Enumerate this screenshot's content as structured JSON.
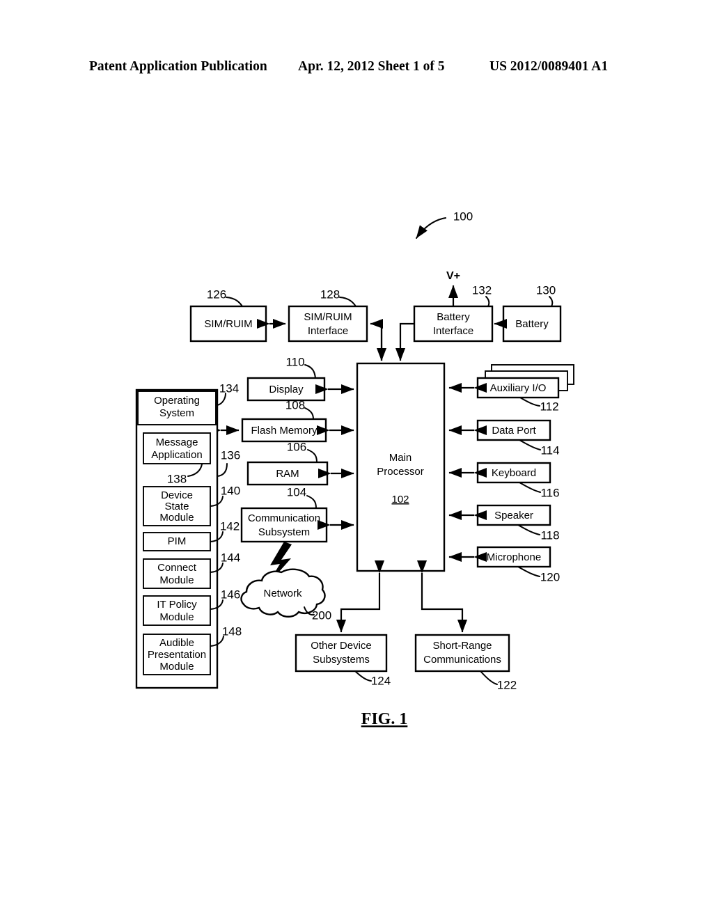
{
  "header": {
    "title": "Patent Application Publication",
    "date": "Apr. 12, 2012",
    "sheet": "Sheet 1 of 5",
    "publication_number": "US 2012/0089401 A1",
    "date_sheet": "Apr. 12, 2012  Sheet 1 of 5"
  },
  "figure": {
    "label": "FIG. 1",
    "overall_ref": "100",
    "power_label": "V+"
  },
  "boxes": {
    "sim_ruim": {
      "label": "SIM/RUIM",
      "ref": "126"
    },
    "sim_ruim_interface": {
      "label_line1": "SIM/RUIM",
      "label_line2": "Interface",
      "ref": "128"
    },
    "battery_interface": {
      "label_line1": "Battery",
      "label_line2": "Interface",
      "ref": "132"
    },
    "battery": {
      "label": "Battery",
      "ref": "130"
    },
    "display": {
      "label": "Display",
      "ref": "110"
    },
    "flash_memory": {
      "label": "Flash Memory",
      "ref": "108"
    },
    "ram": {
      "label": "RAM",
      "ref": "106"
    },
    "communication_subsystem": {
      "label_line1": "Communication",
      "label_line2": "Subsystem",
      "ref": "104"
    },
    "main_processor": {
      "label_line1": "Main",
      "label_line2": "Processor",
      "ref": "102"
    },
    "auxiliary_io": {
      "label": "Auxiliary I/O",
      "ref": "112"
    },
    "data_port": {
      "label": "Data Port",
      "ref": "114"
    },
    "keyboard": {
      "label": "Keyboard",
      "ref": "116"
    },
    "speaker": {
      "label": "Speaker",
      "ref": "118"
    },
    "microphone": {
      "label": "Microphone",
      "ref": "120"
    },
    "network": {
      "label": "Network",
      "ref": "200"
    },
    "other_device_subsystems": {
      "label_line1": "Other Device",
      "label_line2": "Subsystems",
      "ref": "124"
    },
    "short_range_communications": {
      "label_line1": "Short-Range",
      "label_line2": "Communications",
      "ref": "122"
    }
  },
  "operating_system": {
    "title_line1": "Operating",
    "title_line2": "System",
    "title_ref": "134",
    "panel_ref": "136",
    "modules": [
      {
        "lines": [
          "Message",
          "Application"
        ],
        "ref": "138"
      },
      {
        "lines": [
          "Device",
          "State",
          "Module"
        ],
        "ref": "140"
      },
      {
        "lines": [
          "PIM"
        ],
        "ref": "142"
      },
      {
        "lines": [
          "Connect",
          "Module"
        ],
        "ref": "144"
      },
      {
        "lines": [
          "IT Policy",
          "Module"
        ],
        "ref": "146"
      },
      {
        "lines": [
          "Audible",
          "Presentation",
          "Module"
        ],
        "ref": "148"
      }
    ]
  },
  "colors": {
    "ink": "#000000",
    "paper": "#ffffff"
  }
}
